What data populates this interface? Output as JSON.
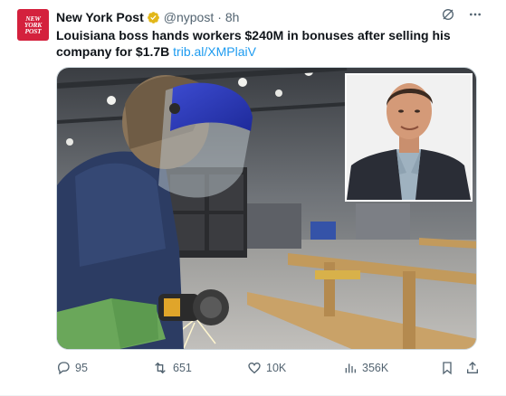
{
  "post": {
    "avatar_text": [
      "NEW",
      "YORK",
      "POST"
    ],
    "display_name": "New York Post",
    "handle": "@nypost",
    "separator": "·",
    "time": "8h",
    "text": "Louisiana boss hands workers $240M in bonuses after selling his company for $1.7B",
    "link": "trib.al/XMPlaiV"
  },
  "actions": {
    "replies": "95",
    "reposts": "651",
    "likes": "10K",
    "views": "356K"
  },
  "colors": {
    "brand_red": "#d4213d",
    "verified_gold": "#e2b719",
    "link_blue": "#1d9bf0",
    "muted_gray": "#536471"
  },
  "icons": [
    "verified-badge-icon",
    "grok-icon",
    "more-icon",
    "reply-icon",
    "repost-icon",
    "like-icon",
    "views-icon",
    "bookmark-icon",
    "share-icon"
  ]
}
